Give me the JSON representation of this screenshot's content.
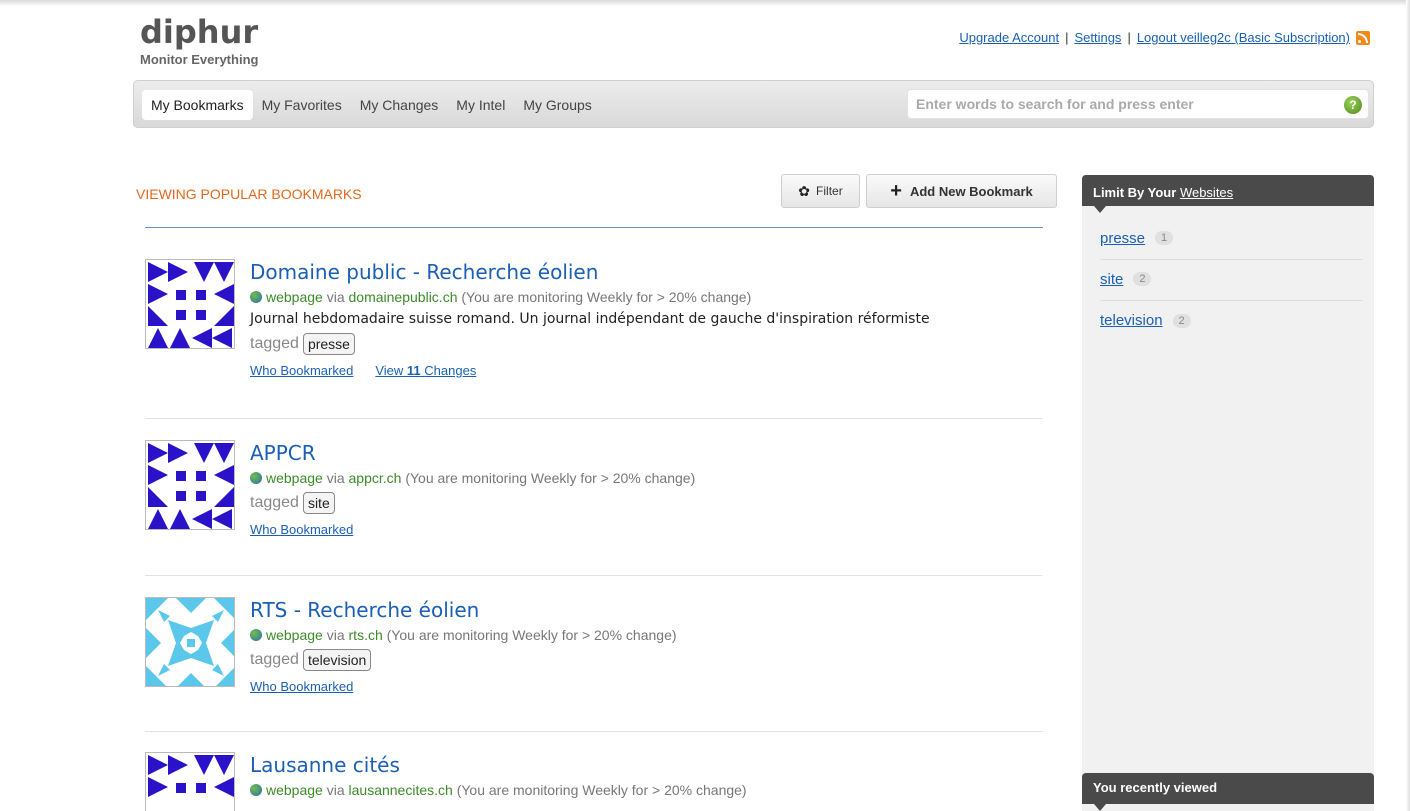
{
  "brand": {
    "logo": "diphur",
    "tagline": "Monitor Everything"
  },
  "toplinks": {
    "upgrade": "Upgrade Account",
    "settings": "Settings",
    "logout": "Logout veilleg2c (Basic Subscription)",
    "sep1": "|",
    "sep2": "|"
  },
  "nav": {
    "tabs": [
      {
        "label": "My Bookmarks"
      },
      {
        "label": "My Favorites"
      },
      {
        "label": "My Changes"
      },
      {
        "label": "My Intel"
      },
      {
        "label": "My Groups"
      }
    ],
    "active_tab": "My Bookmarks"
  },
  "search": {
    "placeholder": "Enter words to search for and press enter",
    "value": "",
    "help": "?"
  },
  "main": {
    "heading": "VIEWING POPULAR BOOKMARKS",
    "filter_label": "Filter",
    "add_label": "Add New Bookmark",
    "bookmarks": [
      {
        "title": "Domaine public - Recherche éolien",
        "type": "webpage",
        "via": "via",
        "site": "domainepublic.ch",
        "monitoring": "(You are monitoring Weekly for > 20% change)",
        "description": "Journal hebdomadaire suisse romand. Un journal indépendant de gauche d'inspiration réformiste",
        "tagged_label": "tagged",
        "tag": "presse",
        "who_link": "Who Bookmarked",
        "changes_prefix": "View",
        "changes_count": "11",
        "changes_suffix": "Changes"
      },
      {
        "title": "APPCR",
        "type": "webpage",
        "via": "via",
        "site": "appcr.ch",
        "monitoring": "(You are monitoring Weekly for > 20% change)",
        "tagged_label": "tagged",
        "tag": "site",
        "who_link": "Who Bookmarked"
      },
      {
        "title": "RTS - Recherche éolien",
        "type": "webpage",
        "via": "via",
        "site": "rts.ch",
        "monitoring": "(You are monitoring Weekly for > 20% change)",
        "tagged_label": "tagged",
        "tag": "television",
        "who_link": "Who Bookmarked"
      },
      {
        "title": "Lausanne cités",
        "type": "webpage",
        "via": "via",
        "site": "lausannecites.ch",
        "monitoring": "(You are monitoring Weekly for > 20% change)"
      }
    ]
  },
  "sidebar": {
    "limit_heading": "Limit By Your",
    "limit_link": "Websites",
    "items": [
      {
        "label": "presse",
        "count": "1"
      },
      {
        "label": "site",
        "count": "2"
      },
      {
        "label": "television",
        "count": "2"
      }
    ],
    "recent_heading": "You recently viewed"
  },
  "colors": {
    "accent_orange": "#e0691d",
    "link_blue": "#1a5fb4",
    "site_green": "#3c8a2a",
    "identicon_blue": "#2a12c8",
    "identicon_cyan": "#5bc7ea"
  }
}
